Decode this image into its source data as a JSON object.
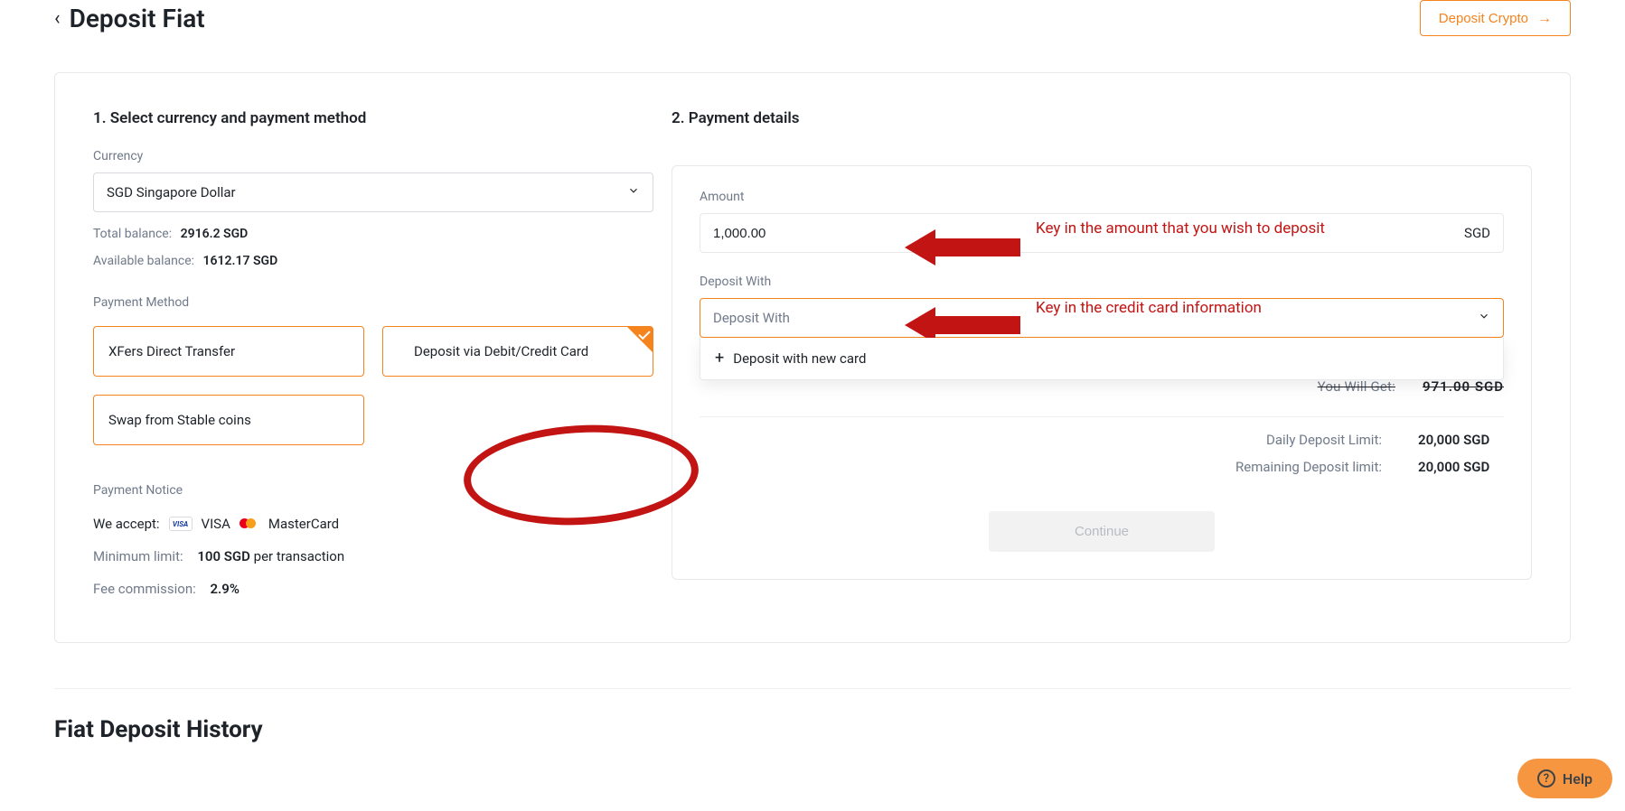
{
  "header": {
    "title": "Deposit Fiat",
    "deposit_crypto": "Deposit Crypto"
  },
  "left": {
    "section_title": "1. Select currency and payment method",
    "currency_label": "Currency",
    "currency_value": "SGD Singapore Dollar",
    "total_balance_label": "Total balance:",
    "total_balance_value": "2916.2 SGD",
    "available_balance_label": "Available balance:",
    "available_balance_value": "1612.17 SGD",
    "payment_method_label": "Payment Method",
    "pm_items": [
      "XFers Direct Transfer",
      "Deposit via Debit/Credit Card",
      "Swap from Stable coins"
    ],
    "notice_title": "Payment Notice",
    "we_accept": "We accept:",
    "visa_label": "VISA",
    "mc_label": "MasterCard",
    "min_limit_label": "Minimum limit:",
    "min_limit_value": "100 SGD",
    "per_tx": "per transaction",
    "fee_label": "Fee commission:",
    "fee_value": "2.9%"
  },
  "right": {
    "section_title": "2. Payment details",
    "amount_label": "Amount",
    "amount_value": "1,000.00",
    "amount_suffix": "SGD",
    "deposit_with_label": "Deposit With",
    "deposit_with_placeholder": "Deposit With",
    "deposit_new_card": "Deposit with new card",
    "you_get_label": "You Will Get:",
    "you_get_value": "971.00 SGD",
    "daily_limit_label": "Daily Deposit Limit:",
    "daily_limit_value": "20,000 SGD",
    "remaining_limit_label": "Remaining Deposit limit:",
    "remaining_limit_value": "20,000 SGD",
    "continue": "Continue"
  },
  "history_title": "Fiat Deposit History",
  "annotations": {
    "amount_hint": "Key in the amount that you wish to deposit",
    "card_hint": "Key in the credit card information"
  },
  "help": "Help"
}
